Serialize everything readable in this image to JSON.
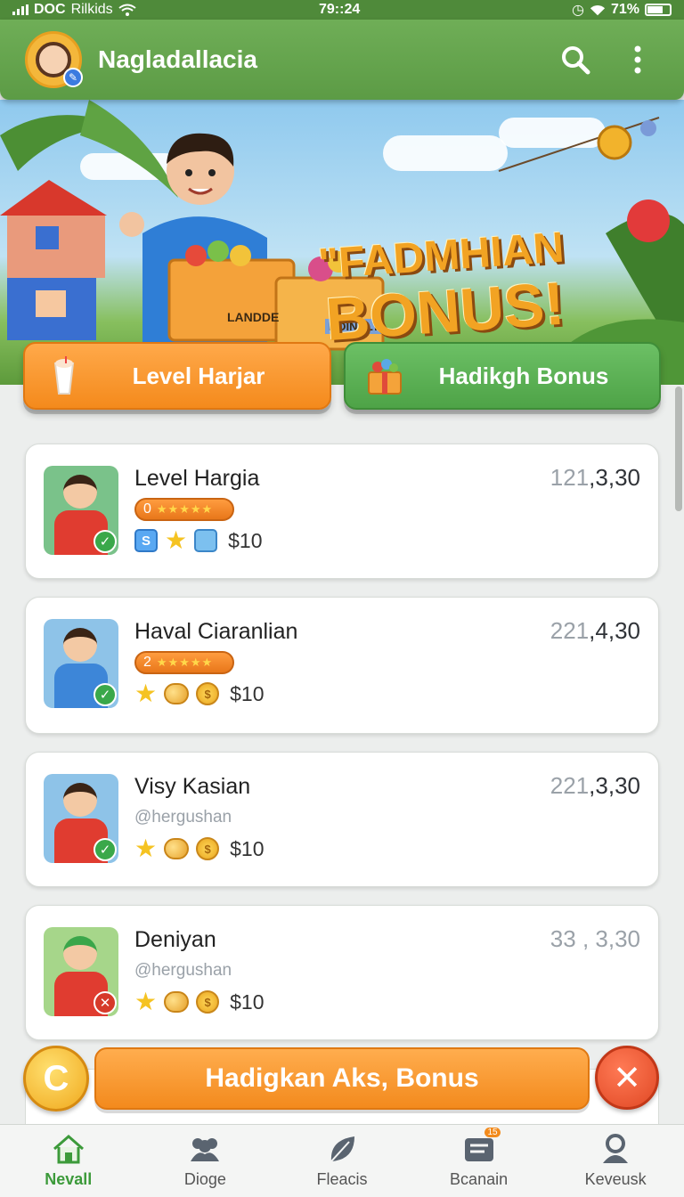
{
  "status_bar": {
    "carrier": "DOC",
    "network": "Rilkids",
    "time": "79::24",
    "battery": "71%"
  },
  "app_bar": {
    "title": "Nagladallacia"
  },
  "hero": {
    "title_line1": "\"FADMHIAN",
    "title_line2": "BONUS!",
    "box_label_1": "LANDDE",
    "box_label_2": "ROINDLY"
  },
  "actions": [
    {
      "label": "Level Harjar"
    },
    {
      "label": "Hadikgh Bonus"
    }
  ],
  "leaderboard": [
    {
      "name": "Level Hargia",
      "score_prefix": "121",
      "score_main": ",3,30",
      "rank": "0",
      "stars": "★★★★★",
      "handle": "",
      "reward": "$10",
      "verified": true
    },
    {
      "name": "Haval Ciaranlian",
      "score_prefix": "221",
      "score_main": ",4,30",
      "rank": "2",
      "stars": "★★★★★",
      "handle": "",
      "reward": "$10",
      "verified": true
    },
    {
      "name": "Visy Kasian",
      "score_prefix": "221",
      "score_main": ",3,30",
      "rank": "",
      "stars": "",
      "handle": "@hergushan",
      "reward": "$10",
      "verified": true
    },
    {
      "name": "Deniyan",
      "score_prefix": "33 , 3,30",
      "score_main": "",
      "rank": "",
      "stars": "",
      "handle": "@hergushan",
      "reward": "$10",
      "verified": false
    }
  ],
  "claim": {
    "label": "Hadigkan  Aks, Bonus",
    "coin_glyph": "C",
    "close_glyph": "✕"
  },
  "bottom_nav": [
    {
      "label": "Nevall",
      "icon": "home-icon",
      "active": true
    },
    {
      "label": "Dioge",
      "icon": "group-icon",
      "active": false
    },
    {
      "label": "Fleacis",
      "icon": "leaf-icon",
      "active": false
    },
    {
      "label": "Bcanain",
      "icon": "inbox-icon",
      "active": false,
      "badge": "15"
    },
    {
      "label": "Keveusk",
      "icon": "profile-icon",
      "active": false
    }
  ],
  "colors": {
    "primary_green": "#5c9b45",
    "accent_orange": "#f48a1c",
    "close_red": "#e04824",
    "active_nav": "#3c9a3a"
  }
}
